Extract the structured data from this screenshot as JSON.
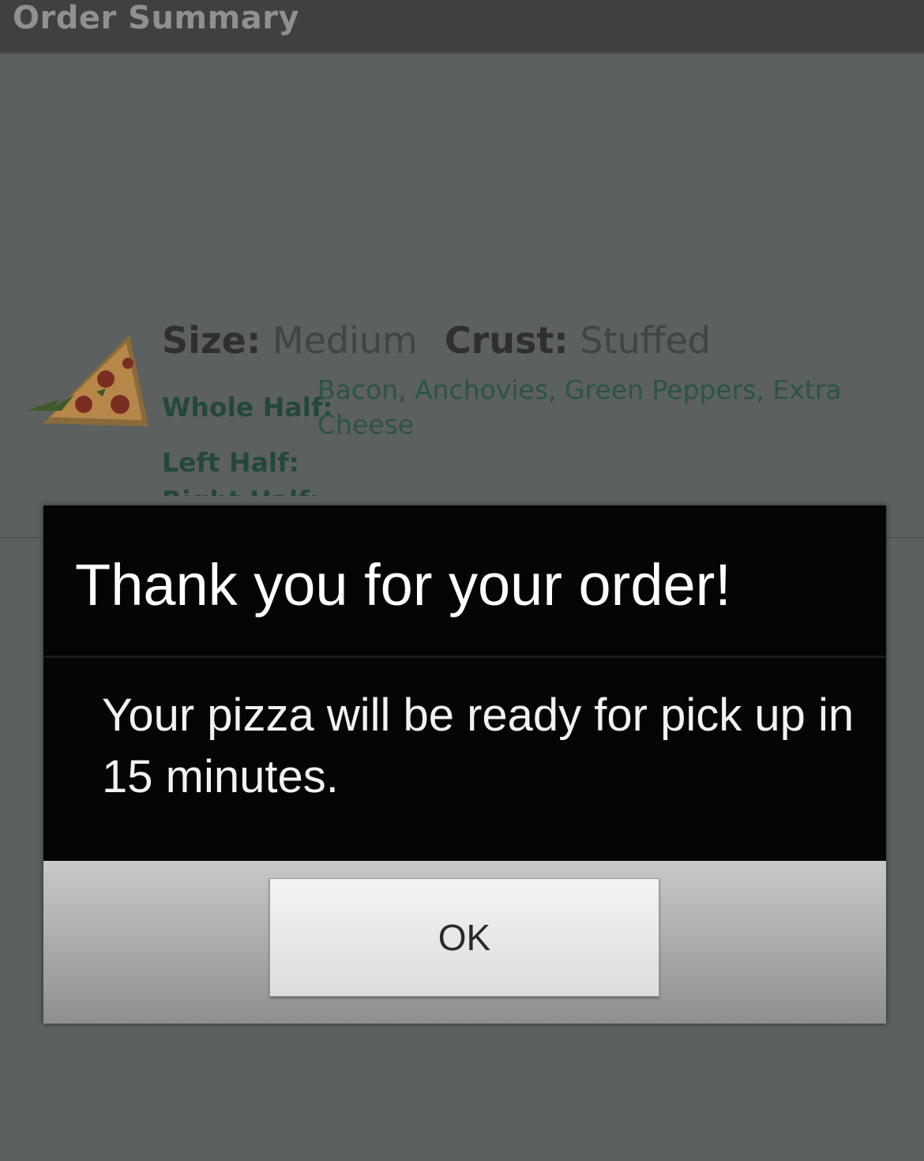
{
  "app": {
    "title": "Order Summary"
  },
  "order": {
    "size_label": "Size:",
    "size_value": "Medium",
    "crust_label": "Crust:",
    "crust_value": "Stuffed",
    "whole_half_label": "Whole Half:",
    "whole_half_value": "Bacon, Anchovies, Green Peppers, Extra Cheese",
    "left_half_label": "Left Half:",
    "right_half_label": "Right Half:"
  },
  "dialog": {
    "title": "Thank you for your order!",
    "message": "Your pizza will be ready for pick up in 15 minutes.",
    "ok_label": "OK"
  },
  "icons": {
    "pizza": "pizza-slice-icon"
  }
}
